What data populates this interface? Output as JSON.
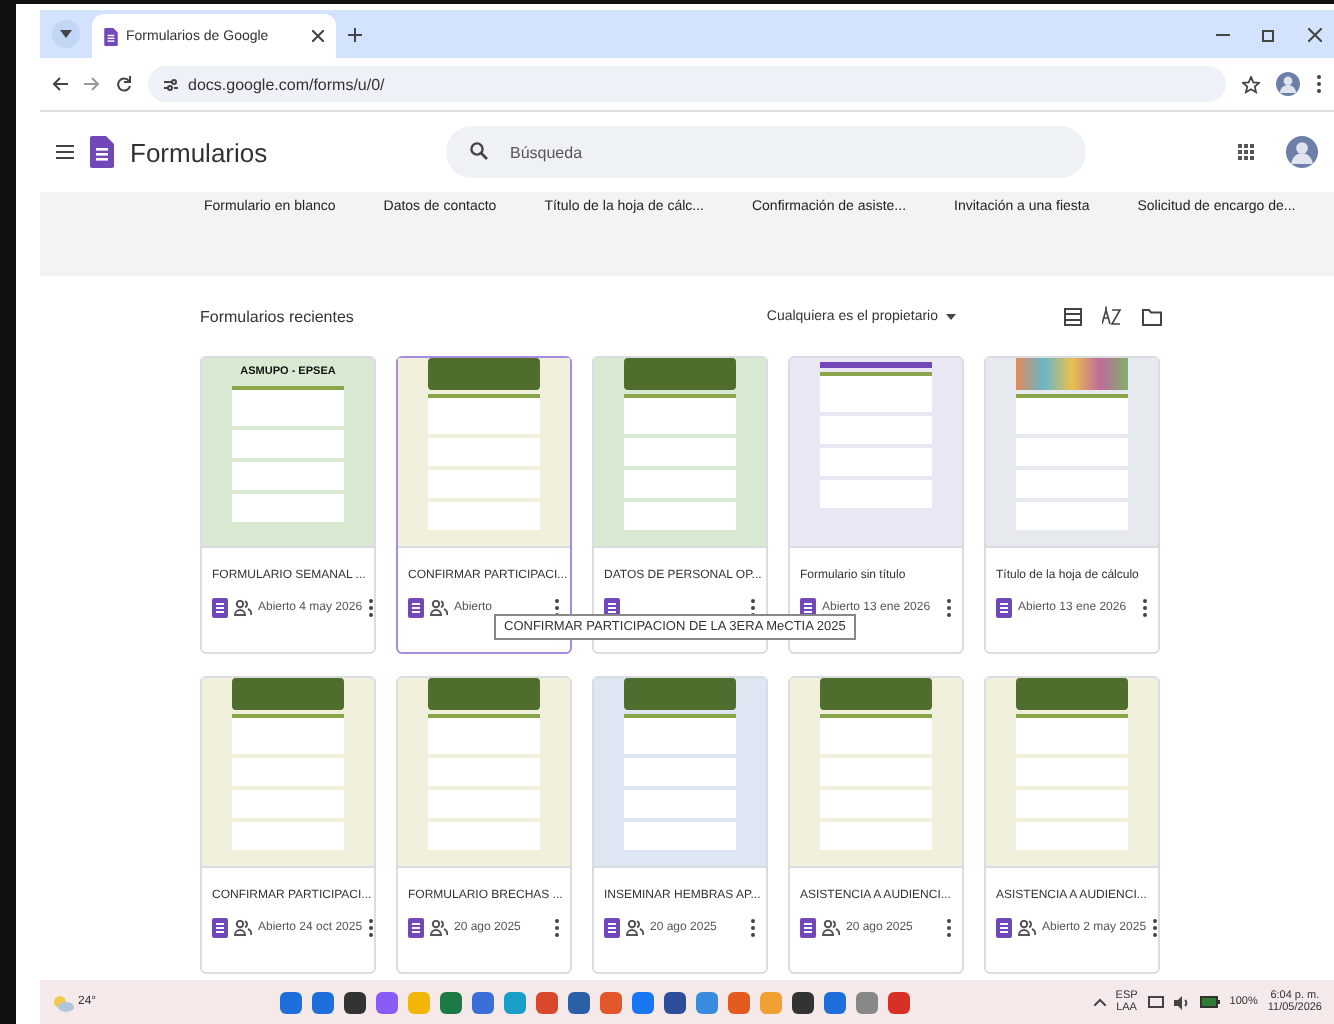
{
  "browser": {
    "tab_title": "Formularios de Google",
    "url": "docs.google.com/forms/u/0/"
  },
  "app": {
    "title": "Formularios",
    "search": {
      "placeholder": "Búsqueda"
    }
  },
  "templates": [
    "Formulario en blanco",
    "Datos de contacto",
    "Título de la hoja de cálc...",
    "Confirmación de asiste...",
    "Invitación a una fiesta",
    "Solicitud de encargo de..."
  ],
  "recent": {
    "heading": "Formularios recientes",
    "owner_filter": "Cualquiera es el propietario",
    "cards": [
      {
        "title": "FORMULARIO SEMANAL ...",
        "meta": "Abierto 4 may 2026",
        "shared": true,
        "hovered": false,
        "color": "#d9ead3",
        "kind": "logo",
        "logo_text": "ASMUPO - EPSEA"
      },
      {
        "title": "CONFIRMAR PARTICIPACI...",
        "meta": "Abierto",
        "shared": true,
        "hovered": true,
        "color": "#f0f0dc",
        "kind": "photo",
        "tooltip": "CONFIRMAR PARTICIPACION DE LA 3ERA MeCTIA 2025"
      },
      {
        "title": "DATOS DE PERSONAL OP...",
        "shared": false,
        "hovered": false,
        "color": "#d9ead3",
        "kind": "photo"
      },
      {
        "title": "Formulario sin título",
        "meta": "Abierto 13 ene 2026",
        "shared": false,
        "hovered": false,
        "color": "#ebe7f5",
        "kind": "bar"
      },
      {
        "title": "Título de la hoja de cálculo",
        "meta": "Abierto 13 ene 2026",
        "shared": false,
        "hovered": false,
        "color": "#e6eaee",
        "kind": "pattern"
      },
      {
        "title": "CONFIRMAR PARTICIPACI...",
        "meta": "Abierto 24 oct 2025",
        "shared": true,
        "hovered": false,
        "color": "#f0f0dc",
        "kind": "photo"
      },
      {
        "title": "FORMULARIO BRECHAS ...",
        "meta": "20 ago 2025",
        "shared": true,
        "hovered": false,
        "color": "#f0f0dc",
        "kind": "photo"
      },
      {
        "title": "INSEMINAR HEMBRAS AP...",
        "meta": "20 ago 2025",
        "shared": true,
        "hovered": false,
        "color": "#dfe6f3",
        "kind": "photo"
      },
      {
        "title": "ASISTENCIA A AUDIENCI...",
        "meta": "20 ago 2025",
        "shared": true,
        "hovered": false,
        "color": "#f0f0dc",
        "kind": "photo"
      },
      {
        "title": "ASISTENCIA A AUDIENCI...",
        "meta": "Abierto 2 may 2025",
        "shared": true,
        "hovered": false,
        "color": "#f0f0dc",
        "kind": "photo"
      }
    ]
  },
  "taskbar": {
    "weather": "24°",
    "apps": [
      {
        "color": "#1e6fd9"
      },
      {
        "color": "#1e6fd9"
      },
      {
        "color": "#333333"
      },
      {
        "color": "#8a5cf6"
      },
      {
        "color": "#f2b705"
      },
      {
        "color": "#1d7a45"
      },
      {
        "color": "#3a6fd8"
      },
      {
        "color": "#1aa0c8"
      },
      {
        "color": "#d9482b"
      },
      {
        "color": "#2b5fa8"
      },
      {
        "color": "#e2572b"
      },
      {
        "color": "#1877f2"
      },
      {
        "color": "#2e4d9a"
      },
      {
        "color": "#3a8dde"
      },
      {
        "color": "#e35b1e"
      },
      {
        "color": "#f0a030"
      },
      {
        "color": "#333333"
      },
      {
        "color": "#1e6fd9"
      },
      {
        "color": "#888888"
      },
      {
        "color": "#d93025"
      }
    ],
    "language": "ESP",
    "layout": "LAA",
    "battery": "100%",
    "time": "6:04 p. m.",
    "date": "11/05/2026"
  }
}
